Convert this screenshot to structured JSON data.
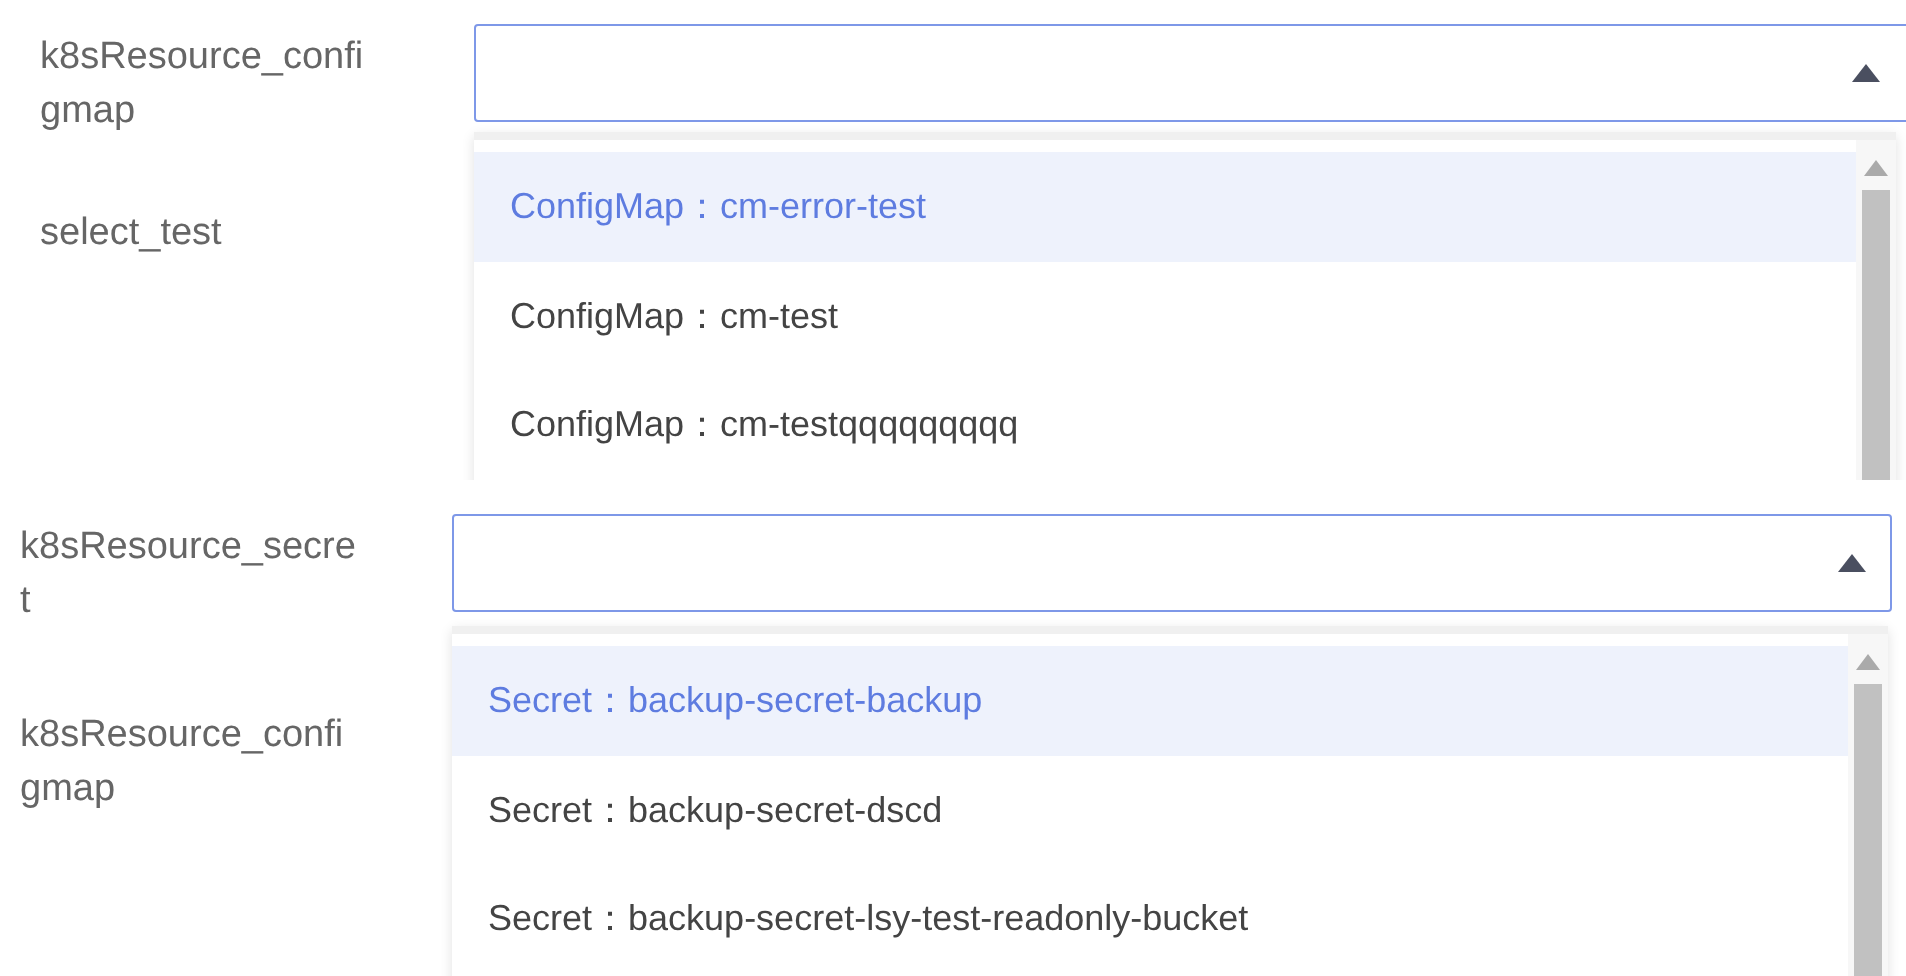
{
  "panels": [
    {
      "select": {
        "label": "k8sResource_configmap",
        "expanded": true,
        "options": [
          {
            "text": "ConfigMap：cm-error-test",
            "selected": true
          },
          {
            "text": "ConfigMap：cm-test",
            "selected": false
          },
          {
            "text": "ConfigMap：cm-testqqqqqqqqq",
            "selected": false
          }
        ]
      },
      "next_label": "select_test"
    },
    {
      "select": {
        "label": "k8sResource_secret",
        "expanded": true,
        "options": [
          {
            "text": "Secret：backup-secret-backup",
            "selected": true
          },
          {
            "text": "Secret：backup-secret-dscd",
            "selected": false
          },
          {
            "text": "Secret：backup-secret-lsy-test-readonly-bucket",
            "selected": false
          }
        ]
      },
      "next_label": "k8sResource_configmap"
    }
  ]
}
